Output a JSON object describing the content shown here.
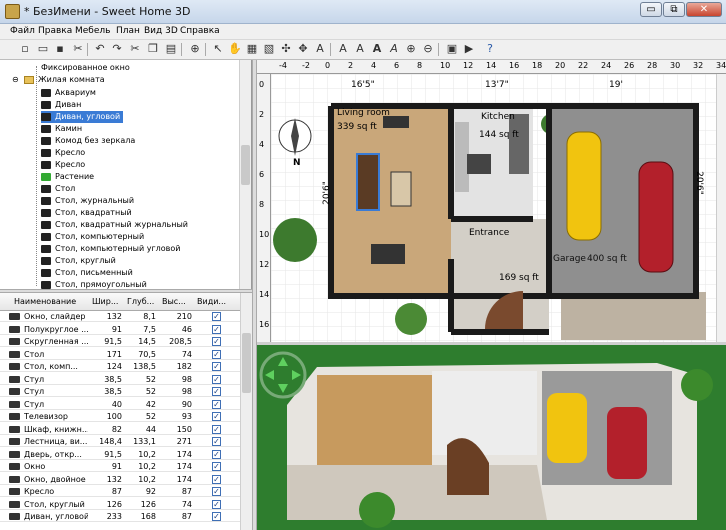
{
  "window": {
    "title": "* БезИмени - Sweet Home 3D",
    "minimize": "▭",
    "maximize": "⧉",
    "close": "✕"
  },
  "menu": [
    "Файл",
    "Правка",
    "Мебель",
    "План",
    "Вид 3D",
    "Справка"
  ],
  "toolbar_icons": [
    "new-file-icon",
    "open-icon",
    "save-icon",
    "cut-icon",
    "copy-icon",
    "paste-icon",
    "undo-icon",
    "redo-icon",
    "cut2-icon",
    "copy2-icon",
    "paste2-icon",
    "add-furniture-icon",
    "select-icon",
    "pan-icon",
    "create-walls-icon",
    "create-rooms-icon",
    "create-dimensions-icon",
    "add-text-icon",
    "modify-text-icon",
    "text-bold-icon",
    "text-italic-icon",
    "increase-text-icon",
    "decrease-text-icon",
    "zoom-in-icon",
    "zoom-out-icon",
    "create-photo-icon",
    "create-video-icon",
    "help-icon"
  ],
  "catalog": {
    "top_item": "Фиксированное окно",
    "category": "Жилая комната",
    "items": [
      "Аквариум",
      "Диван",
      "Диван, угловой",
      "Камин",
      "Комод без зеркала",
      "Кресло",
      "Кресло",
      "Растение",
      "Стол",
      "Стол, журнальный",
      "Стол, квадратный",
      "Стол, квадратный журнальный",
      "Стол, компьютерный",
      "Стол, компьютерный угловой",
      "Стол, круглый",
      "Стол, письменный",
      "Стол, прямоугольный"
    ],
    "selected_index": 2
  },
  "furniture_table": {
    "headers": [
      "Наименование",
      "Шир...",
      "Глуб...",
      "Выс...",
      "Види..."
    ],
    "rows": [
      {
        "name": "Окно, слайдер",
        "w": "132",
        "d": "8,1",
        "h": "210"
      },
      {
        "name": "Полукруглое ...",
        "w": "91",
        "d": "7,5",
        "h": "46"
      },
      {
        "name": "Скругленная ...",
        "w": "91,5",
        "d": "14,5",
        "h": "208,5"
      },
      {
        "name": "Стол",
        "w": "171",
        "d": "70,5",
        "h": "74"
      },
      {
        "name": "Стол, комп...",
        "w": "124",
        "d": "138,5",
        "h": "182"
      },
      {
        "name": "Стул",
        "w": "38,5",
        "d": "52",
        "h": "98"
      },
      {
        "name": "Стул",
        "w": "38,5",
        "d": "52",
        "h": "98"
      },
      {
        "name": "Стул",
        "w": "40",
        "d": "42",
        "h": "90"
      },
      {
        "name": "Телевизор",
        "w": "100",
        "d": "52",
        "h": "93"
      },
      {
        "name": "Шкаф, книжн...",
        "w": "82",
        "d": "44",
        "h": "150"
      },
      {
        "name": "Лестница, ви...",
        "w": "148,4",
        "d": "133,1",
        "h": "271"
      },
      {
        "name": "Дверь, откр...",
        "w": "91,5",
        "d": "10,2",
        "h": "174"
      },
      {
        "name": "Окно",
        "w": "91",
        "d": "10,2",
        "h": "174"
      },
      {
        "name": "Окно, двойное",
        "w": "132",
        "d": "10,2",
        "h": "174"
      },
      {
        "name": "Кресло",
        "w": "87",
        "d": "92",
        "h": "87"
      },
      {
        "name": "Стол, круглый",
        "w": "126",
        "d": "126",
        "h": "74"
      },
      {
        "name": "Диван, угловой",
        "w": "233",
        "h": "87",
        "d": "168"
      }
    ],
    "checked": "✓"
  },
  "plan": {
    "ruler_top": [
      "-4",
      "-2",
      "0",
      "2",
      "4",
      "6",
      "8",
      "10",
      "12",
      "14",
      "16",
      "18",
      "20",
      "22",
      "24",
      "26",
      "28",
      "30",
      "32",
      "34"
    ],
    "ruler_left": [
      "0",
      "2",
      "4",
      "6",
      "8",
      "10",
      "12",
      "14",
      "16"
    ],
    "dim_top_1": "16'5\"",
    "dim_top_2": "13'7\"",
    "dim_top_3": "19'",
    "dim_left": "20'6\"",
    "dim_right": "20'6\"",
    "compass_n": "N",
    "rooms": [
      {
        "name": "Living room",
        "area": "339 sq ft"
      },
      {
        "name": "Kitchen",
        "area": "144 sq ft"
      },
      {
        "name": "Entrance",
        "area": "169 sq ft"
      },
      {
        "name": "Garage",
        "area": "400 sq ft"
      }
    ]
  },
  "colors": {
    "selection": "#3a7bd5",
    "wall": "#1a1a1a",
    "floor_wood": "#c9a77a",
    "floor_tile": "#d8d8d8",
    "garage_floor": "#8f8f8f",
    "grass": "#2e7d2e",
    "car_yellow": "#f1c40f",
    "car_red": "#b3202b"
  }
}
